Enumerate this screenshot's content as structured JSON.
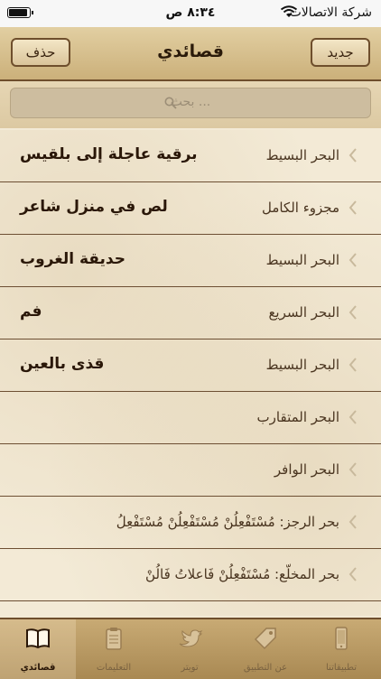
{
  "status": {
    "time": "٨:٣٤ ص",
    "carrier": "شركة الاتصالات"
  },
  "nav": {
    "title": "قصائدي",
    "left_button": "حذف",
    "right_button": "جديد"
  },
  "search": {
    "placeholder": "بحث ..."
  },
  "rows": [
    {
      "meter": "البحر البسيط",
      "name": "برقية عاجلة إلى بلقيس"
    },
    {
      "meter": "مجزوء الكامل",
      "name": "لص في منزل شاعر"
    },
    {
      "meter": "البحر البسيط",
      "name": "حديقة الغروب"
    },
    {
      "meter": "البحر السريع",
      "name": "فم"
    },
    {
      "meter": "البحر البسيط",
      "name": "قذى بالعين"
    },
    {
      "meter": "البحر المتقارب",
      "name": ""
    },
    {
      "meter": "البحر الوافر",
      "name": ""
    }
  ],
  "verse_rows": [
    {
      "text": "بحر الرجز: مُسْتَفْعِلُنْ مُسْتَفْعِلُنْ مُسْتَفْعِلُ"
    },
    {
      "text": "بحر المخلّع: مُسْتَفْعِلُنْ فَاعلاتُ فَالُنْ"
    }
  ],
  "tabs": [
    {
      "label": "تطبيقاتنا",
      "icon": "phone-icon"
    },
    {
      "label": "عن التطبيق",
      "icon": "tag-icon"
    },
    {
      "label": "تويتر",
      "icon": "twitter-icon"
    },
    {
      "label": "التعليمات",
      "icon": "clipboard-icon"
    },
    {
      "label": "قصائدي",
      "icon": "book-icon",
      "active": true
    }
  ]
}
